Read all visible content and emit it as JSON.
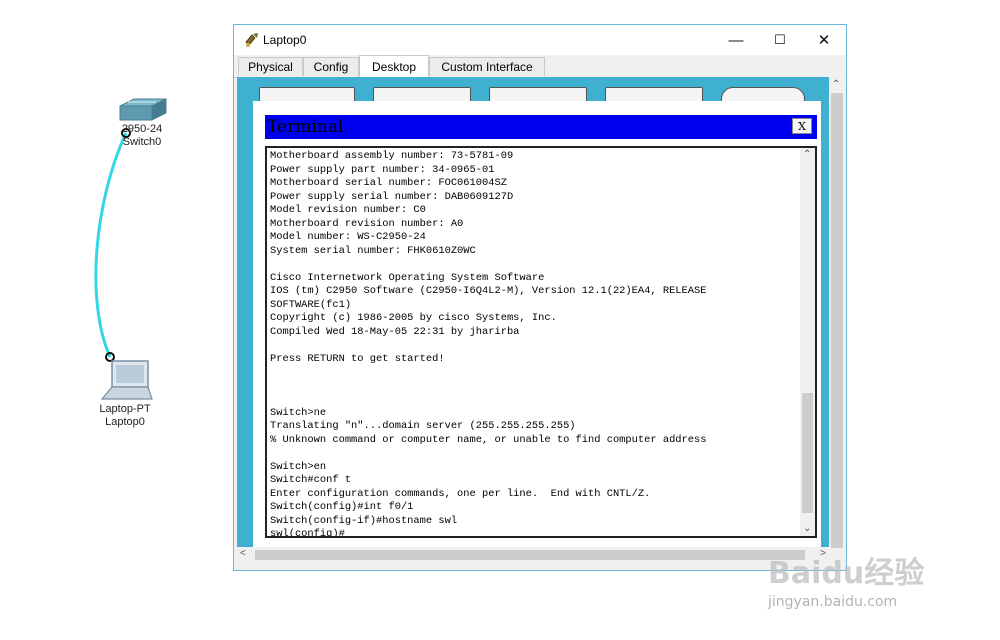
{
  "topology": {
    "switch": {
      "model": "2950-24",
      "name": "Switch0"
    },
    "laptop": {
      "model": "Laptop-PT",
      "name": "Laptop0"
    },
    "cable_color": "#33d6e6"
  },
  "window": {
    "title": "Laptop0",
    "minimize_glyph": "—",
    "maximize_glyph": "☐",
    "close_glyph": "✕"
  },
  "tabs": [
    {
      "label": "Physical",
      "active": false
    },
    {
      "label": "Config",
      "active": false
    },
    {
      "label": "Desktop",
      "active": true
    },
    {
      "label": "Custom Interface",
      "active": false
    }
  ],
  "terminal": {
    "title": "Terminal",
    "close_label": "X",
    "lines": [
      "Motherboard assembly number: 73-5781-09",
      "Power supply part number: 34-0965-01",
      "Motherboard serial number: FOC061004SZ",
      "Power supply serial number: DAB0609127D",
      "Model revision number: C0",
      "Motherboard revision number: A0",
      "Model number: WS-C2950-24",
      "System serial number: FHK0610Z0WC",
      "",
      "Cisco Internetwork Operating System Software",
      "IOS (tm) C2950 Software (C2950-I6Q4L2-M), Version 12.1(22)EA4, RELEASE",
      "SOFTWARE(fc1)",
      "Copyright (c) 1986-2005 by cisco Systems, Inc.",
      "Compiled Wed 18-May-05 22:31 by jharirba",
      "",
      "Press RETURN to get started!",
      "",
      "",
      "",
      "Switch>ne",
      "Translating \"n\"...domain server (255.255.255.255)",
      "% Unknown command or computer name, or unable to find computer address",
      "",
      "Switch>en",
      "Switch#conf t",
      "Enter configuration commands, one per line.  End with CNTL/Z.",
      "Switch(config)#int f0/1",
      "Switch(config-if)#hostname swl",
      "swl(config)#"
    ]
  },
  "watermark": {
    "brand": "Baidu经验",
    "url": "jingyan.baidu.com"
  }
}
